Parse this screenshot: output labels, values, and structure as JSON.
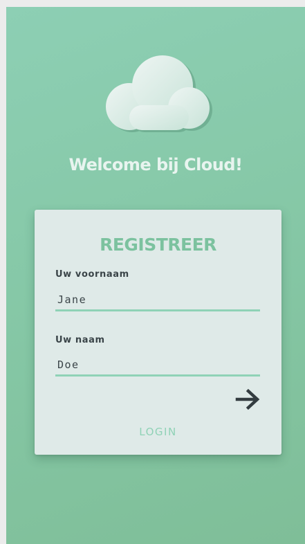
{
  "app": {
    "welcome_text": "Welcome bij Cloud!",
    "logo_icon": "cloud-icon"
  },
  "register_form": {
    "title": "REGISTREER",
    "first_name_label": "Uw voornaam",
    "first_name_value": "Jane",
    "last_name_label": "Uw naam",
    "last_name_value": "Doe",
    "submit_icon": "arrow-right-icon",
    "login_link": "LOGIN"
  },
  "colors": {
    "background_top": "#8dcfb4",
    "background_bottom": "#7fbe98",
    "card_background": "#dfeae8",
    "accent_green": "#7cc29f",
    "input_underline": "#8fd2b6",
    "text_dark": "#3a4448",
    "welcome_text": "#e8f4ef"
  }
}
